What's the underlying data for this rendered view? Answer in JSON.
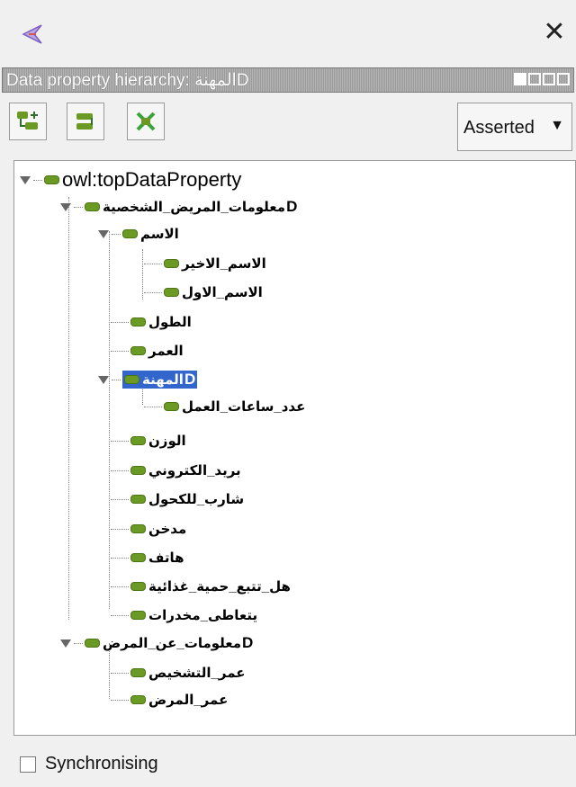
{
  "window": {
    "close_glyph": "✕"
  },
  "view_header": {
    "title": "Data property hierarchy: المهنةD"
  },
  "toolbar": {
    "add_sub_icon": "add-sub-property-icon",
    "add_sibling_icon": "add-sibling-property-icon",
    "delete_icon": "delete-property-icon",
    "mode_label": "Asserted",
    "mode_arrow": "▼"
  },
  "tree": {
    "root": "owl:topDataProperty",
    "patient_info": "معلومات_المريض_الشخصية",
    "name": "الاسم",
    "last_name": "الاسم_الاخير",
    "first_name": "الاسم_الاول",
    "height": "الطول",
    "age": "العمر",
    "occupation": "المهنة",
    "work_hours": "عدد_ساعات_العمل",
    "weight": "الوزن",
    "email": "بريد_الكتروني",
    "drinks_alcohol": "شارب_للكحول",
    "smoker": "مدخن",
    "phone": "هاتف",
    "diet": "هل_تتبع_حمية_غذائية",
    "drugs": "يتعاطى_مخدرات",
    "disease_info": "معلومات_عن_المرض",
    "diagnosis_age": "عمر_التشخيص",
    "disease_age": "عمر_المرض",
    "d_mark": "D"
  },
  "footer": {
    "sync_label": "Synchronising"
  },
  "colors": {
    "bullet": "#6b9a24",
    "selection": "#3366cc"
  }
}
